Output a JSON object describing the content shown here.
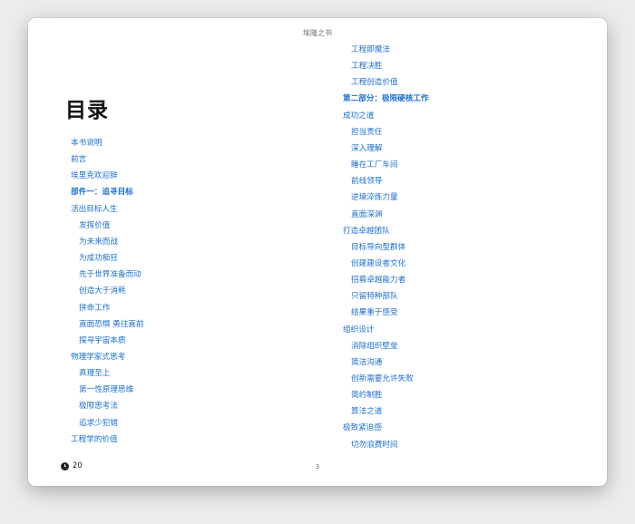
{
  "header": {
    "book_title": "埃隆之书"
  },
  "toc": {
    "heading": "目录",
    "left": [
      {
        "label": "本书说明",
        "bold": false,
        "indent": false
      },
      {
        "label": "前言",
        "bold": false,
        "indent": false
      },
      {
        "label": "埃里克欢迎辞",
        "bold": false,
        "indent": false
      },
      {
        "label": "部件一：追寻目标",
        "bold": true,
        "indent": false
      },
      {
        "label": "活出目标人生",
        "bold": false,
        "indent": false
      },
      {
        "label": "发挥价值",
        "bold": false,
        "indent": true
      },
      {
        "label": "为未来而战",
        "bold": false,
        "indent": true
      },
      {
        "label": "为成功痴狂",
        "bold": false,
        "indent": true
      },
      {
        "label": "先于世界准备而动",
        "bold": false,
        "indent": true
      },
      {
        "label": "创造大于消耗",
        "bold": false,
        "indent": true
      },
      {
        "label": "拼命工作",
        "bold": false,
        "indent": true
      },
      {
        "label": "直面恐惧 勇往直前",
        "bold": false,
        "indent": true
      },
      {
        "label": "探寻宇宙本质",
        "bold": false,
        "indent": true
      },
      {
        "label": "物理学家式思考",
        "bold": false,
        "indent": false
      },
      {
        "label": "真理至上",
        "bold": false,
        "indent": true
      },
      {
        "label": "第一性原理思维",
        "bold": false,
        "indent": true
      },
      {
        "label": "极限思考法",
        "bold": false,
        "indent": true
      },
      {
        "label": "追求少犯错",
        "bold": false,
        "indent": true
      },
      {
        "label": "工程学的价值",
        "bold": false,
        "indent": false
      }
    ],
    "right": [
      {
        "label": "工程即魔法",
        "bold": false,
        "indent": true
      },
      {
        "label": "工程决胜",
        "bold": false,
        "indent": true
      },
      {
        "label": "工程创造价值",
        "bold": false,
        "indent": true
      },
      {
        "label": "第二部分：极限硬核工作",
        "bold": true,
        "indent": false
      },
      {
        "label": "成功之道",
        "bold": false,
        "indent": false
      },
      {
        "label": "担当责任",
        "bold": false,
        "indent": true
      },
      {
        "label": "深入理解",
        "bold": false,
        "indent": true
      },
      {
        "label": "睡在工厂车间",
        "bold": false,
        "indent": true
      },
      {
        "label": "前线领导",
        "bold": false,
        "indent": true
      },
      {
        "label": "逆境淬炼力量",
        "bold": false,
        "indent": true
      },
      {
        "label": "直面深渊",
        "bold": false,
        "indent": true
      },
      {
        "label": "打造卓越团队",
        "bold": false,
        "indent": false
      },
      {
        "label": "目标导向型群体",
        "bold": false,
        "indent": true
      },
      {
        "label": "创建建设者文化",
        "bold": false,
        "indent": true
      },
      {
        "label": "招募卓越能力者",
        "bold": false,
        "indent": true
      },
      {
        "label": "只留特种部队",
        "bold": false,
        "indent": true
      },
      {
        "label": "结果重于感受",
        "bold": false,
        "indent": true
      },
      {
        "label": "组织设计",
        "bold": false,
        "indent": false
      },
      {
        "label": "消除组织壁垒",
        "bold": false,
        "indent": true
      },
      {
        "label": "简洁沟通",
        "bold": false,
        "indent": true
      },
      {
        "label": "创新需要允许失败",
        "bold": false,
        "indent": true
      },
      {
        "label": "简约制胜",
        "bold": false,
        "indent": true
      },
      {
        "label": "算法之道",
        "bold": false,
        "indent": true
      },
      {
        "label": "极致紧迫感",
        "bold": false,
        "indent": false
      },
      {
        "label": "切勿浪费时间",
        "bold": false,
        "indent": true
      }
    ]
  },
  "footer": {
    "time_left": "20",
    "time_icon": "clock-icon",
    "page_number": "3"
  },
  "colors": {
    "link": "#1a6fd0",
    "heading": "#111111",
    "background": "#ececec"
  }
}
